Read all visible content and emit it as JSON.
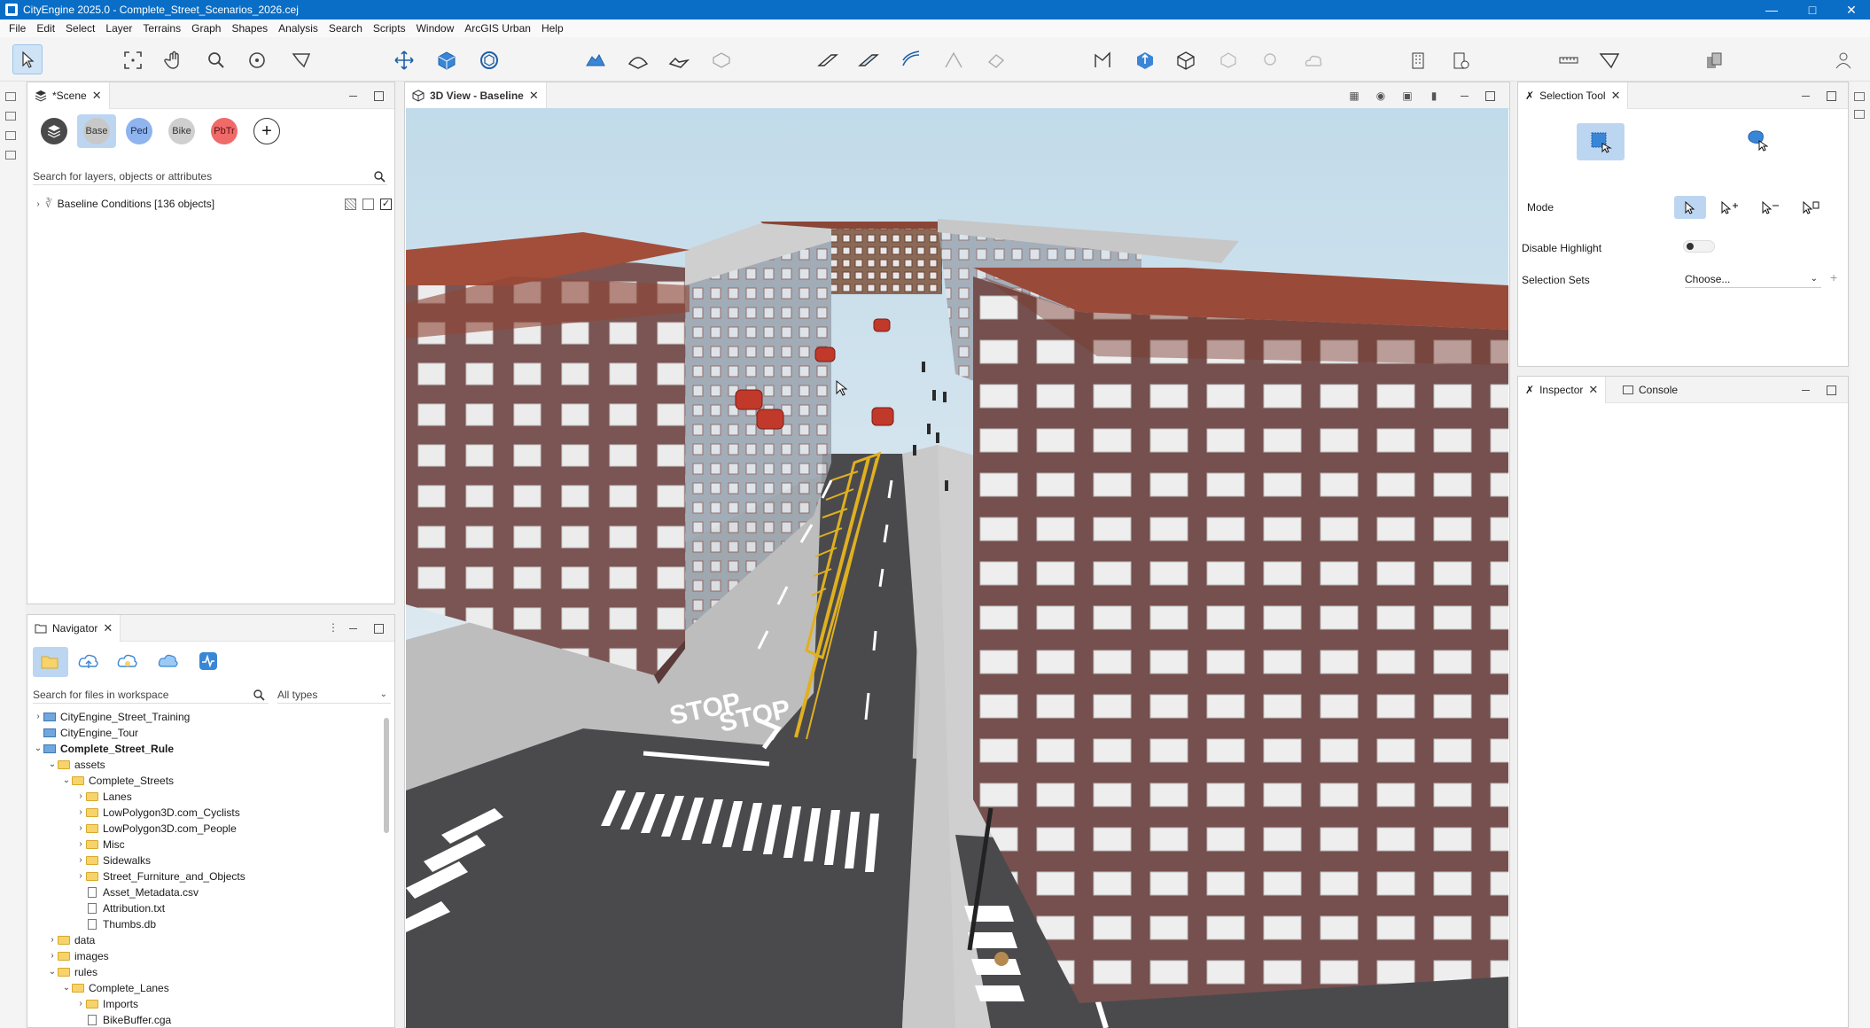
{
  "window": {
    "title": "CityEngine 2025.0 - Complete_Street_Scenarios_2026.cej"
  },
  "menu": [
    "File",
    "Edit",
    "Select",
    "Layer",
    "Terrains",
    "Graph",
    "Shapes",
    "Analysis",
    "Search",
    "Scripts",
    "Window",
    "ArcGIS Urban",
    "Help"
  ],
  "scene_panel": {
    "tab_label": "*Scene",
    "layer_buttons": [
      "Base",
      "Ped",
      "Bike",
      "PbTr"
    ],
    "search_placeholder": "Search for layers, objects or attributes",
    "layers": [
      {
        "label": "Baseline Conditions [136 objects]"
      }
    ]
  },
  "navigator": {
    "tab_label": "Navigator",
    "search_placeholder": "Search for files in workspace",
    "filter": "All types",
    "tree": [
      {
        "label": "CityEngine_Street_Training",
        "level": 0,
        "kind": "project",
        "expand": ">",
        "bold": false
      },
      {
        "label": "CityEngine_Tour",
        "level": 0,
        "kind": "project",
        "expand": "",
        "bold": false
      },
      {
        "label": "Complete_Street_Rule",
        "level": 0,
        "kind": "project",
        "expand": "v",
        "bold": true
      },
      {
        "label": "assets",
        "level": 1,
        "kind": "folder",
        "expand": "v",
        "bold": false
      },
      {
        "label": "Complete_Streets",
        "level": 2,
        "kind": "folder",
        "expand": "v",
        "bold": false
      },
      {
        "label": "Lanes",
        "level": 3,
        "kind": "folder",
        "expand": ">",
        "bold": false
      },
      {
        "label": "LowPolygon3D.com_Cyclists",
        "level": 3,
        "kind": "folder",
        "expand": ">",
        "bold": false
      },
      {
        "label": "LowPolygon3D.com_People",
        "level": 3,
        "kind": "folder",
        "expand": ">",
        "bold": false
      },
      {
        "label": "Misc",
        "level": 3,
        "kind": "folder",
        "expand": ">",
        "bold": false
      },
      {
        "label": "Sidewalks",
        "level": 3,
        "kind": "folder",
        "expand": ">",
        "bold": false
      },
      {
        "label": "Street_Furniture_and_Objects",
        "level": 3,
        "kind": "folder",
        "expand": ">",
        "bold": false
      },
      {
        "label": "Asset_Metadata.csv",
        "level": 3,
        "kind": "file",
        "expand": "",
        "bold": false
      },
      {
        "label": "Attribution.txt",
        "level": 3,
        "kind": "file",
        "expand": "",
        "bold": false
      },
      {
        "label": "Thumbs.db",
        "level": 3,
        "kind": "file",
        "expand": "",
        "bold": false
      },
      {
        "label": "data",
        "level": 1,
        "kind": "folder",
        "expand": ">",
        "bold": false
      },
      {
        "label": "images",
        "level": 1,
        "kind": "folder",
        "expand": ">",
        "bold": false
      },
      {
        "label": "rules",
        "level": 1,
        "kind": "folder",
        "expand": "v",
        "bold": false
      },
      {
        "label": "Complete_Lanes",
        "level": 2,
        "kind": "folder",
        "expand": "v",
        "bold": false
      },
      {
        "label": "Imports",
        "level": 3,
        "kind": "folder",
        "expand": ">",
        "bold": false
      },
      {
        "label": "BikeBuffer.cga",
        "level": 3,
        "kind": "file",
        "expand": "",
        "bold": false
      }
    ]
  },
  "view3d": {
    "tab_label": "3D View - Baseline",
    "road_text": [
      "STOP",
      "STOP"
    ]
  },
  "selection_tool": {
    "tab_label": "Selection Tool",
    "mode_label": "Mode",
    "disable_highlight_label": "Disable Highlight",
    "disable_highlight_on": false,
    "selection_sets_label": "Selection Sets",
    "selection_sets_value": "Choose..."
  },
  "bottom_right": {
    "tabs": [
      "Inspector",
      "Console"
    ]
  },
  "colors": {
    "titlebar": "#0a6ec7",
    "accent": "#3a86d6",
    "building": "#7b5553",
    "roof": "#9a4a38",
    "road": "#4a4a4d",
    "sky": "#cfe2ee"
  }
}
